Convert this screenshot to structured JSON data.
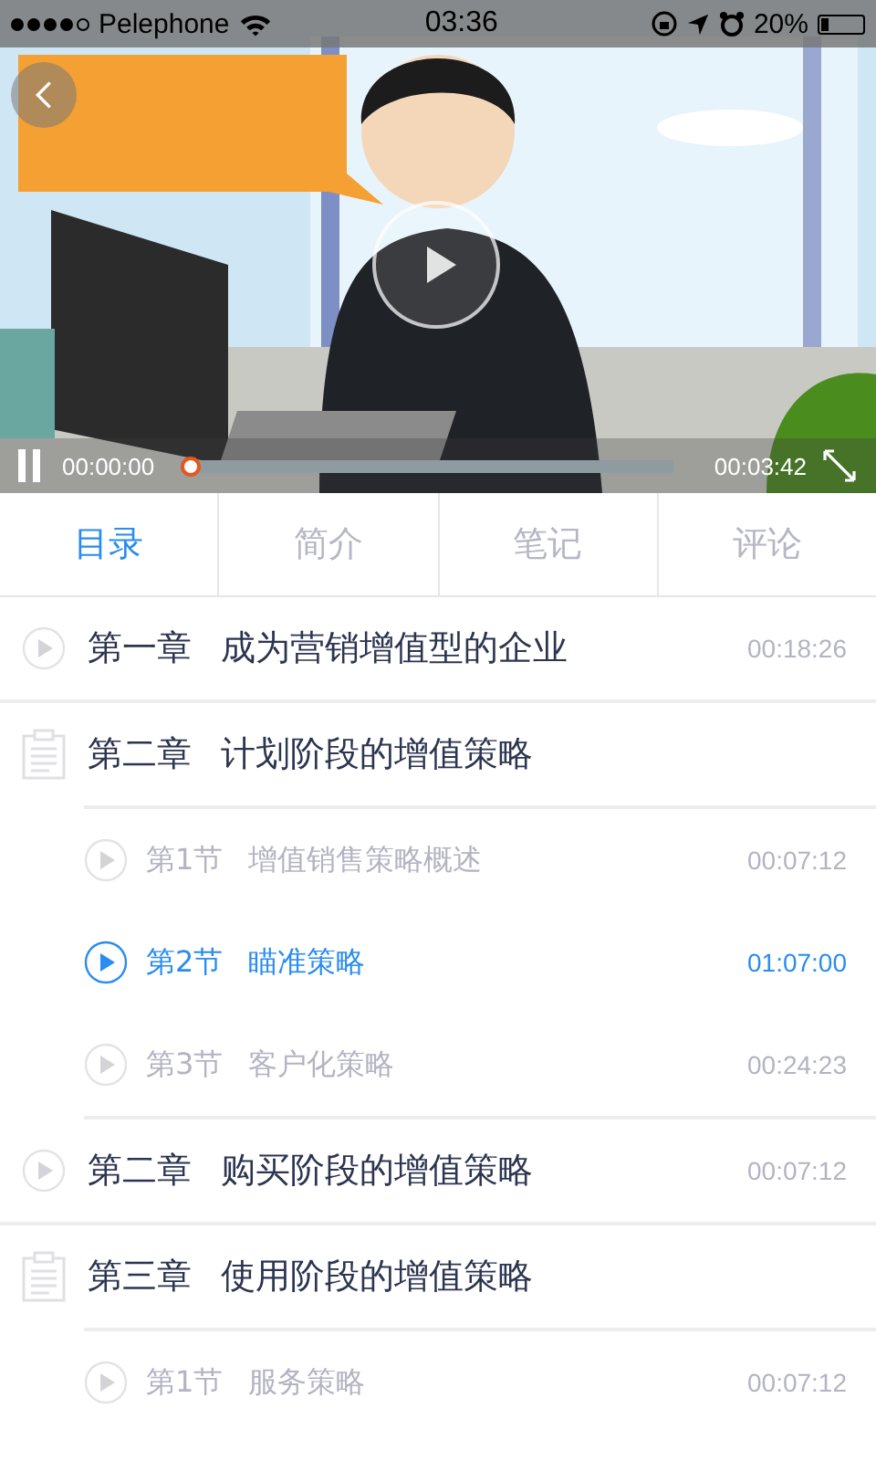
{
  "status_bar": {
    "carrier": "Pelephone",
    "time": "03:36",
    "battery": "20%"
  },
  "player": {
    "elapsed": "00:00:00",
    "duration": "00:03:42",
    "level": 0
  },
  "tabs": [
    {
      "label": "目录",
      "selected": true
    },
    {
      "label": "简介",
      "selected": false
    },
    {
      "label": "笔记",
      "selected": false
    },
    {
      "label": "评论",
      "selected": false
    }
  ],
  "chapters": [
    {
      "kind": "video",
      "number": "第一章",
      "title": "成为营销增值型的企业",
      "duration": "00:18:26"
    },
    {
      "kind": "folder",
      "number": "第二章",
      "title": "计划阶段的增值策略",
      "children": [
        {
          "number": "第1节",
          "title": "增值销售策略概述",
          "duration": "00:07:12",
          "selected": false
        },
        {
          "number": "第2节",
          "title": "瞄准策略",
          "duration": "01:07:00",
          "selected": true
        },
        {
          "number": "第3节",
          "title": "客户化策略",
          "duration": "00:24:23",
          "selected": false
        }
      ]
    },
    {
      "kind": "video",
      "number": "第二章",
      "title": "购买阶段的增值策略",
      "duration": "00:07:12"
    },
    {
      "kind": "folder",
      "number": "第三章",
      "title": "使用阶段的增值策略",
      "children": [
        {
          "number": "第1节",
          "title": "服务策略",
          "duration": "00:07:12",
          "selected": false
        }
      ]
    }
  ]
}
